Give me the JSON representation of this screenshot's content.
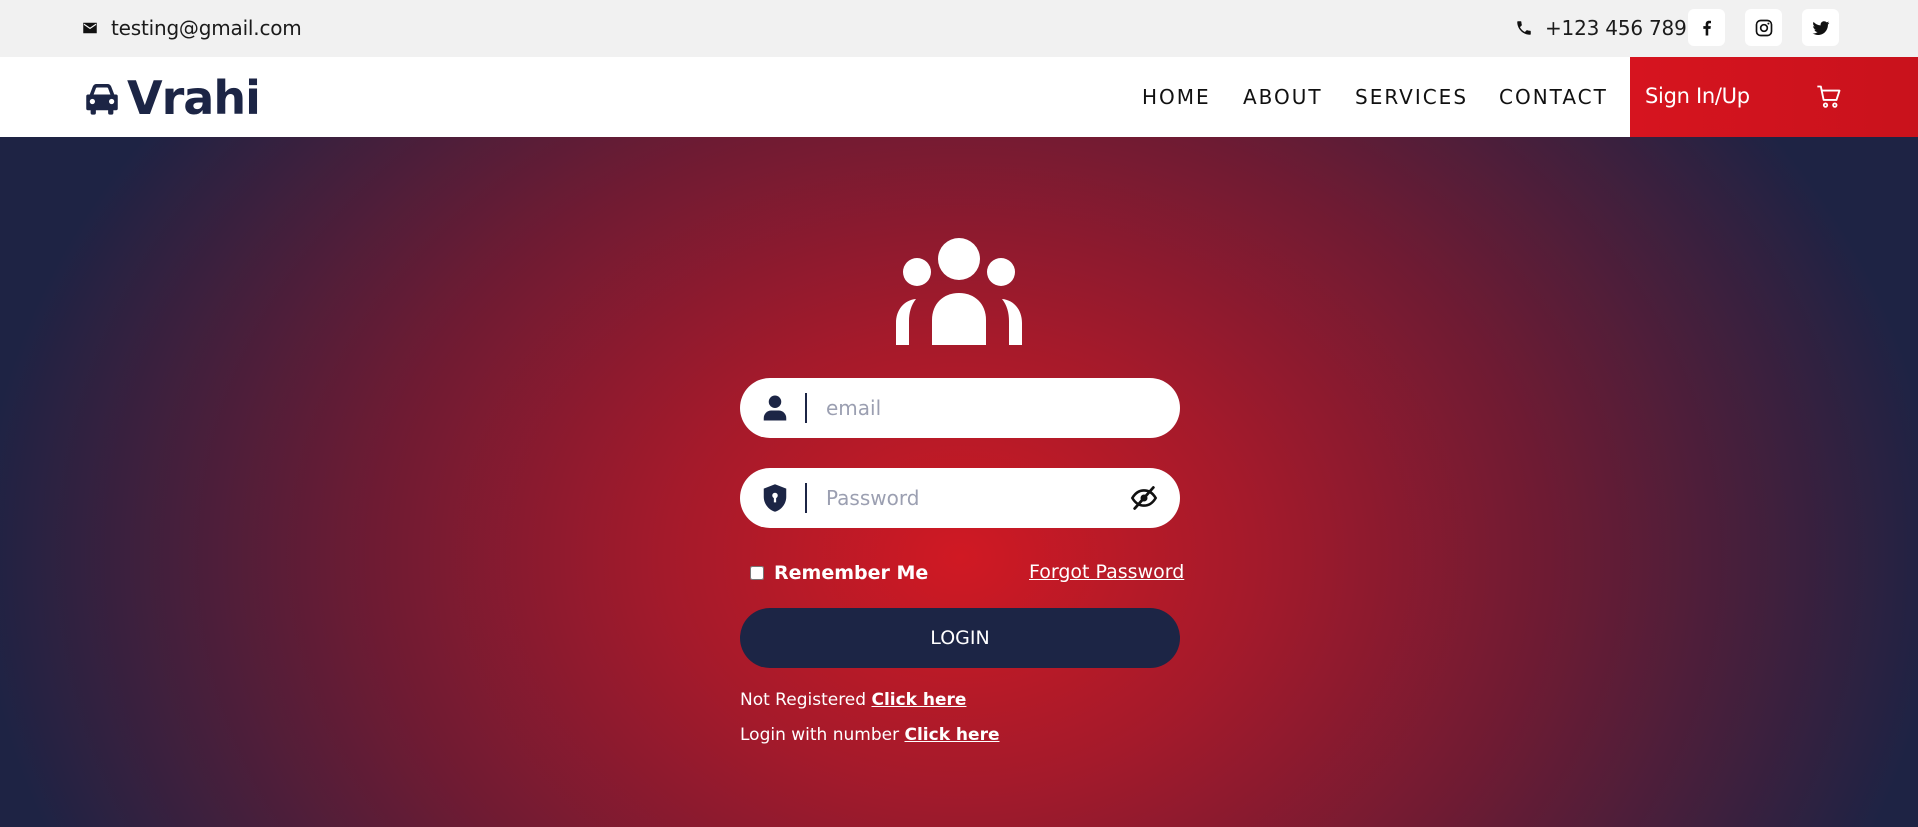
{
  "topbar": {
    "email": "testing@gmail.com",
    "phone": "+123 456 789",
    "icons": {
      "email": "mail-icon",
      "phone": "phone-icon",
      "social": [
        "facebook-icon",
        "instagram-icon",
        "twitter-icon"
      ]
    }
  },
  "navbar": {
    "brand": "Vrahi",
    "brand_icon": "car-icon",
    "links": [
      "HOME",
      "ABOUT",
      "SERVICES",
      "CONTACT"
    ],
    "signin_label": "Sign In/Up",
    "cart_icon": "cart-icon"
  },
  "login": {
    "email_placeholder": "email",
    "password_placeholder": "Password",
    "remember_label": "Remember Me",
    "forgot_label": "Forgot Password",
    "login_button": "LOGIN",
    "not_registered_text": "Not Registered",
    "not_registered_link": "Click here",
    "login_number_text": "Login with number",
    "login_number_link": "Click here"
  },
  "colors": {
    "navy": "#1c2545",
    "red": "#d6141f",
    "topbar_bg": "#f1f1f1"
  }
}
